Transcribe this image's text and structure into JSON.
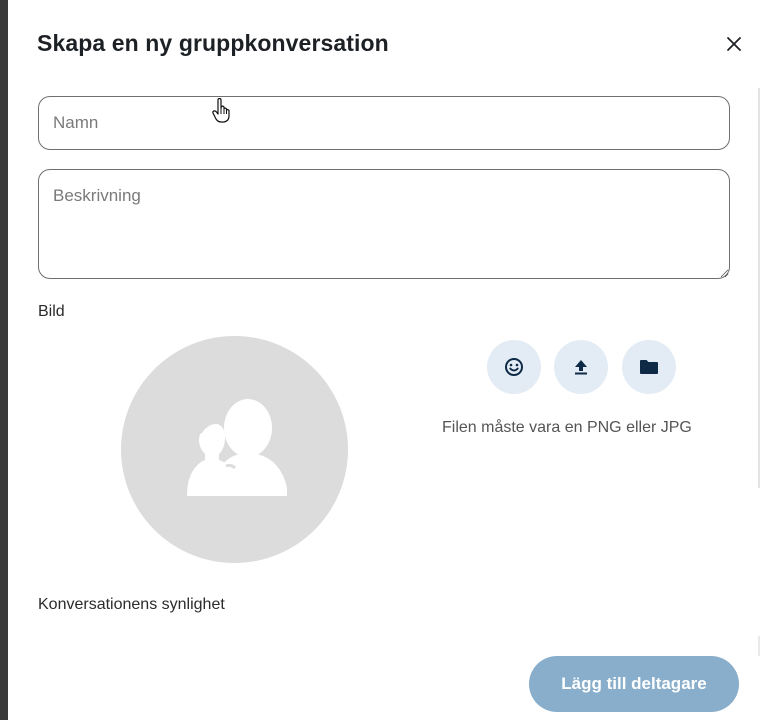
{
  "dialog": {
    "title": "Skapa en ny gruppkonversation",
    "close_icon": "close-icon"
  },
  "form": {
    "name_placeholder": "Namn",
    "name_value": "",
    "description_placeholder": "Beskrivning",
    "description_value": "",
    "image_label": "Bild",
    "image_buttons": [
      {
        "icon": "emoji-icon"
      },
      {
        "icon": "upload-icon"
      },
      {
        "icon": "folder-icon"
      }
    ],
    "file_hint": "Filen måste vara en PNG eller JPG",
    "visibility_label": "Konversationens synlighet"
  },
  "actions": {
    "add_participants_label": "Lägg till deltagare"
  },
  "colors": {
    "accent_button": "#89aecb",
    "icon_button_bg": "#e3ecf4",
    "icon_color": "#0f2a47",
    "avatar_bg": "#dcdcdc"
  }
}
